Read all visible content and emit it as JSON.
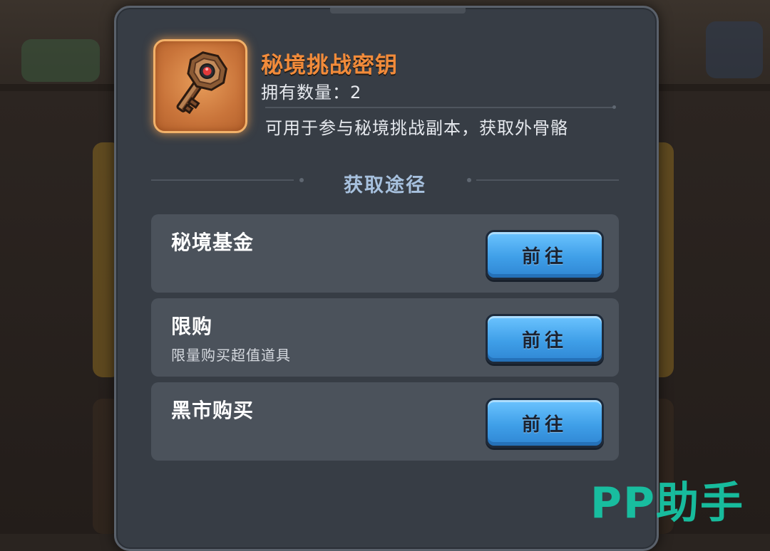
{
  "item": {
    "name": "秘境挑战密钥",
    "owned_label": "拥有数量：",
    "owned_value": "2",
    "description": "可用于参与秘境挑战副本，获取外骨骼",
    "icon": "key-icon"
  },
  "section": {
    "title": "获取途径"
  },
  "sources": [
    {
      "title": "秘境基金",
      "subtitle": "",
      "button": "前往"
    },
    {
      "title": "限购",
      "subtitle": "限量购买超值道具",
      "button": "前往"
    },
    {
      "title": "黑市购买",
      "subtitle": "",
      "button": "前往"
    }
  ],
  "watermark": "PP助手",
  "colors": {
    "item_name": "#f28b3a",
    "section_title": "#a7c1de",
    "button": "#4aa8ee",
    "watermark": "#17c4a4"
  }
}
